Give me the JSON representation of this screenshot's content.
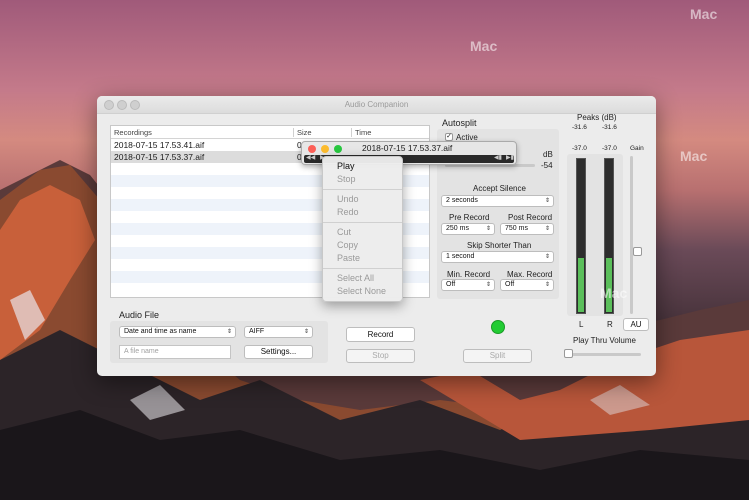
{
  "window": {
    "title": "Audio Companion"
  },
  "table": {
    "columns": [
      "Recordings",
      "Size",
      "Time"
    ],
    "rows": [
      {
        "name": "2018-07-15 17.53.41.aif",
        "size": "0."
      },
      {
        "name": "2018-07-15 17.53.37.aif",
        "size": "0"
      }
    ]
  },
  "audio_file": {
    "title": "Audio File",
    "naming": "Date and time as name",
    "format": "AIFF",
    "filename_placeholder": "A file name",
    "settings_label": "Settings..."
  },
  "buttons": {
    "record": "Record",
    "stop": "Stop",
    "split": "Split"
  },
  "autosplit": {
    "title": "Autosplit",
    "active_label": "Active",
    "active_checked": true,
    "db_label": "dB",
    "db_value": "-54",
    "accept_silence_label": "Accept Silence",
    "accept_silence": "2 seconds",
    "pre_record_label": "Pre Record",
    "pre_record": "250 ms",
    "post_record_label": "Post Record",
    "post_record": "750 ms",
    "skip_shorter_label": "Skip Shorter Than",
    "skip_shorter": "1 second",
    "min_record_label": "Min. Record",
    "min_record": "Off",
    "max_record_label": "Max. Record",
    "max_record": "Off"
  },
  "meters": {
    "title": "Peaks (dB)",
    "peak_left": "-31.6",
    "peak_right": "-31.6",
    "level_left": "-37.0",
    "level_right": "-37.0",
    "gain_label": "Gain",
    "left_label": "L",
    "right_label": "R",
    "au_label": "AU",
    "play_thru_label": "Play Thru Volume",
    "left_fill": 0.35,
    "right_fill": 0.35
  },
  "player": {
    "filename": "2018-07-15 17.53.37.aif"
  },
  "context_menu": {
    "items": [
      {
        "label": "Play",
        "enabled": true
      },
      {
        "label": "Stop",
        "enabled": false
      },
      {
        "sep": true
      },
      {
        "label": "Undo",
        "enabled": false
      },
      {
        "label": "Redo",
        "enabled": false
      },
      {
        "sep": true
      },
      {
        "label": "Cut",
        "enabled": false
      },
      {
        "label": "Copy",
        "enabled": false
      },
      {
        "label": "Paste",
        "enabled": false
      },
      {
        "sep": true
      },
      {
        "label": "Select All",
        "enabled": false
      },
      {
        "label": "Select None",
        "enabled": false
      }
    ]
  },
  "colors": {
    "status_dot": "#22cc33",
    "meter_fill": "#5bbf5b"
  }
}
